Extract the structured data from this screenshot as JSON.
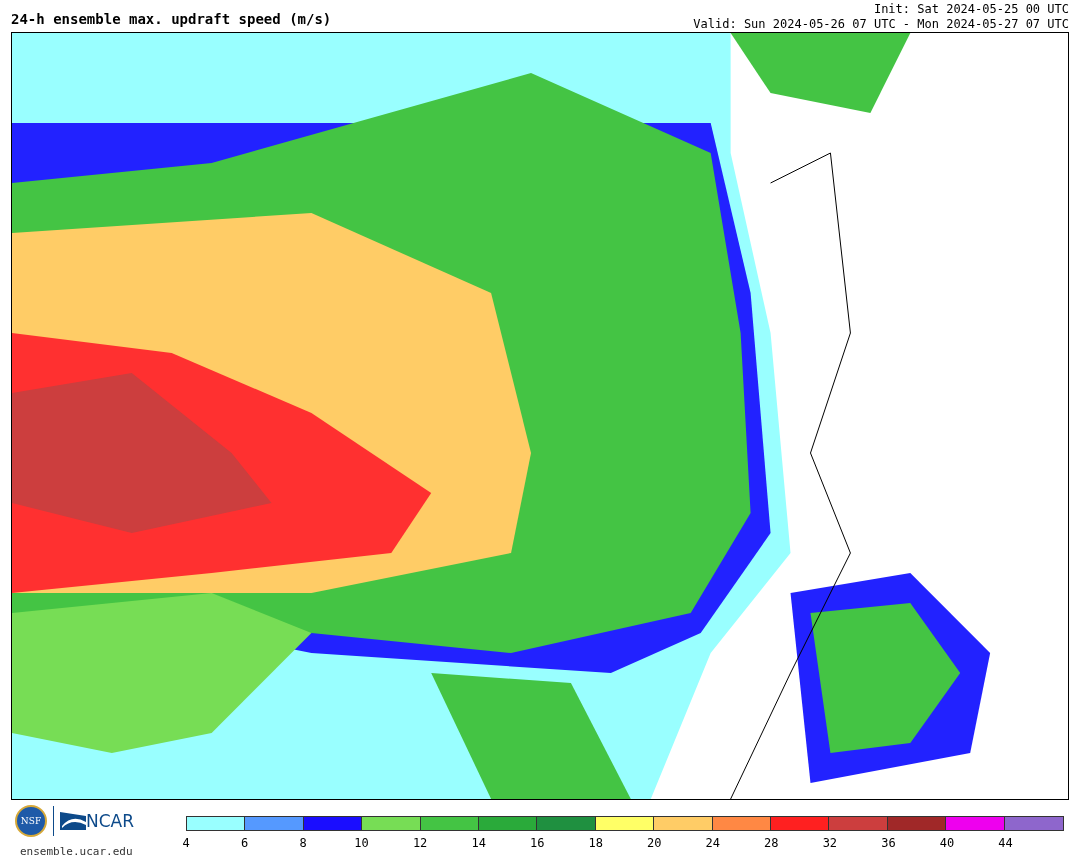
{
  "title": "24-h ensemble max. updraft speed (m/s)",
  "init": "Init: Sat 2024-05-25 00 UTC",
  "valid": "Valid: Sun 2024-05-26 07 UTC - Mon 2024-05-27 07 UTC",
  "logos": {
    "nsf": "NSF",
    "ncar": "NCAR",
    "url": "ensemble.ucar.edu"
  },
  "colorbar": {
    "segments": [
      {
        "color": "#99ffff"
      },
      {
        "color": "#5599ff"
      },
      {
        "color": "#1a0dff"
      },
      {
        "color": "#77dd55"
      },
      {
        "color": "#44c444"
      },
      {
        "color": "#2aaa3a"
      },
      {
        "color": "#1f9040"
      },
      {
        "color": "#ffff66"
      },
      {
        "color": "#ffcc66"
      },
      {
        "color": "#ff8844"
      },
      {
        "color": "#ff2020"
      },
      {
        "color": "#cc3e3e"
      },
      {
        "color": "#a02828"
      },
      {
        "color": "#ee00ee"
      },
      {
        "color": "#8e66cc"
      }
    ],
    "labels": [
      "4",
      "6",
      "8",
      "10",
      "12",
      "14",
      "16",
      "18",
      "20",
      "24",
      "28",
      "32",
      "36",
      "40",
      "44"
    ]
  }
}
